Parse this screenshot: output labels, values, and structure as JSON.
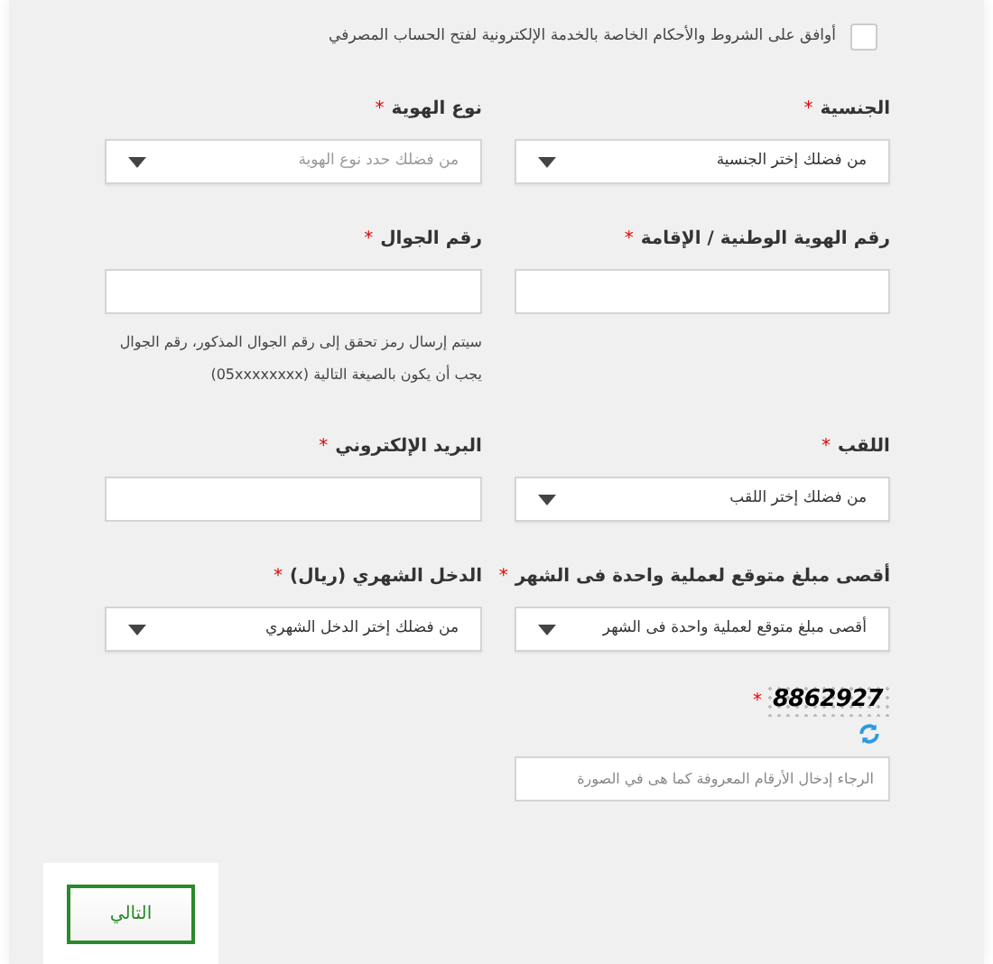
{
  "terms": {
    "label": "أوافق على الشروط والأحكام الخاصة بالخدمة الإلكترونية لفتح الحساب المصرفي",
    "checked": false
  },
  "rows": [
    [
      {
        "label": "الجنسية",
        "required_mark": "*",
        "kind": "select",
        "placeholder": "من فضلك إختر الجنسية",
        "disabled": false
      },
      {
        "label": "نوع الهوية",
        "required_mark": "*",
        "kind": "select",
        "placeholder": "من فضلك حدد نوع الهوية",
        "disabled": true
      }
    ],
    [
      {
        "label": "رقم الهوية الوطنية / الإقامة",
        "required_mark": "*",
        "kind": "text"
      },
      {
        "label": "رقم الجوال",
        "required_mark": "*",
        "kind": "text",
        "hint": "سيتم إرسال رمز تحقق إلى رقم الجوال المذكور، رقم الجوال يجب أن يكون بالصيغة التالية  (05xxxxxxxx)"
      }
    ],
    [
      {
        "label": "اللقب",
        "required_mark": "*",
        "kind": "select",
        "placeholder": "من فضلك إختر اللقب",
        "disabled": false
      },
      {
        "label": "البريد الإلكتروني",
        "required_mark": "*",
        "kind": "text"
      }
    ],
    [
      {
        "label": "أقصى مبلغ متوقع لعملية واحدة فى الشهر",
        "required_mark": "*",
        "kind": "select",
        "placeholder": "أقصى مبلغ متوقع لعملية واحدة فى الشهر",
        "disabled": false
      },
      {
        "label": "الدخل الشهري (ريال)",
        "required_mark": "*",
        "kind": "select",
        "placeholder": "من فضلك إختر الدخل الشهري",
        "disabled": false
      }
    ]
  ],
  "captcha": {
    "code": "8862927",
    "required_mark": "*",
    "placeholder": "الرجاء إدخال الأرقام المعروفة كما هى في الصورة"
  },
  "next_button": "التالي"
}
